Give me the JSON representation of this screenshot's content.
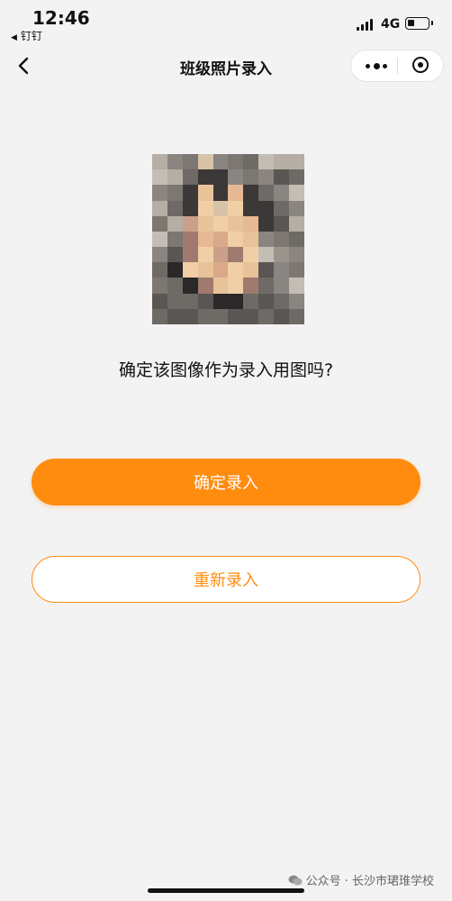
{
  "status_bar": {
    "time": "12:46",
    "back_app": "钉钉",
    "network": "4G",
    "battery_level": 0.35
  },
  "nav": {
    "title": "班级照片录入",
    "back_icon": "chevron-left-icon",
    "more_icon": "more-dots-icon",
    "close_icon": "target-circle-icon"
  },
  "photo": {
    "description_icon": "pixelated-student-portrait"
  },
  "prompt": {
    "question": "确定该图像作为录入用图吗?"
  },
  "actions": {
    "confirm_label": "确定录入",
    "retake_label": "重新录入"
  },
  "watermark": {
    "text": "公众号 · 长沙市珺琟学校"
  },
  "colors": {
    "accent": "#ff8c0f",
    "background": "#f3f3f3"
  }
}
